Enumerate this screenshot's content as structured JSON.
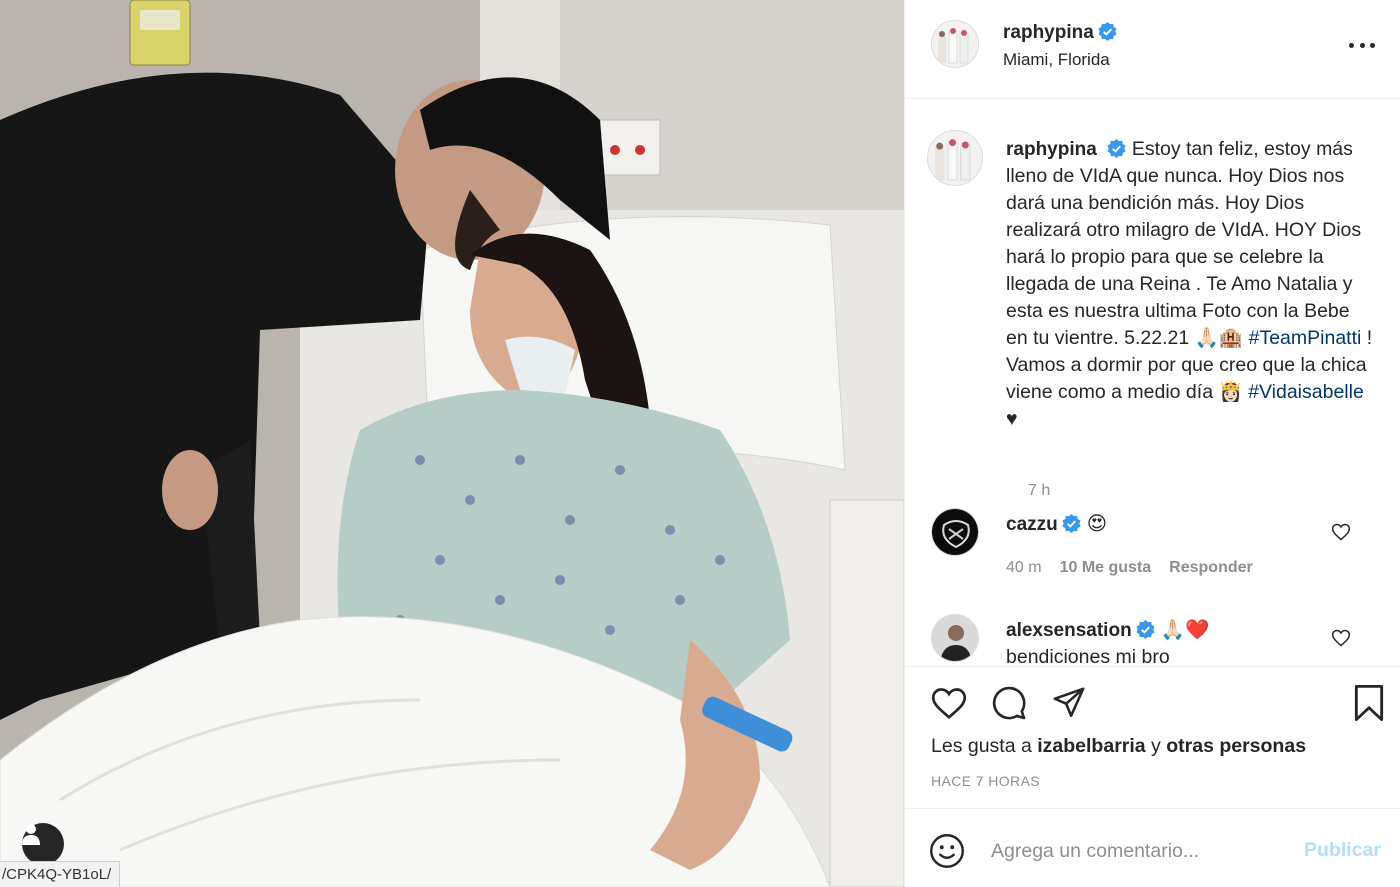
{
  "photo": {
    "url_tooltip": "/CPK4Q-YB1oL/",
    "user_tag_icon": "person-icon"
  },
  "post": {
    "author": "raphypina",
    "location": "Miami, Florida",
    "more_icon": "more-horizontal-icon"
  },
  "caption": {
    "username": "raphypina",
    "text_before_tag1": "Estoy tan feliz, estoy más lleno de VIdA que nunca. Hoy Dios nos dará una bendición más. Hoy Dios realizará otro milagro de VIdA. HOY Dios hará lo propio para que se celebre la llegada de una Reina . Te Amo Natalia y esta es nuestra ultima Foto con la Bebe en tu vientre. 5.22.21 🙏🏻🏨 ",
    "hashtag1": "#TeamPinatti",
    "text_between": " ! Vamos a dormir por que creo que la chica viene como a medio día 👸🏻 ",
    "hashtag2": "#Vidaisabelle",
    "text_after": " ♥",
    "time": "7 h"
  },
  "comments": [
    {
      "username": "cazzu",
      "text": "😍",
      "time": "40 m",
      "likes": "10 Me gusta",
      "reply": "Responder"
    },
    {
      "username": "alexsensation",
      "text": "🙏🏻❤️",
      "body_continued": "bendiciones mi bro"
    }
  ],
  "actions": {
    "like_icon": "heart-icon",
    "comment_icon": "comment-icon",
    "share_icon": "paper-plane-icon",
    "save_icon": "bookmark-icon"
  },
  "likes": {
    "prefix": "Les gusta a ",
    "user": "izabelbarria",
    "middle": " y ",
    "others": "otras personas"
  },
  "posted_ago": "HACE 7 HORAS",
  "comment_form": {
    "placeholder": "Agrega un comentario...",
    "publish_label": "Publicar"
  },
  "colors": {
    "verified": "#3897f0",
    "hashtag": "#00376b",
    "publish_disabled": "#b2dffc",
    "secondary_text": "#8e8e8e"
  }
}
